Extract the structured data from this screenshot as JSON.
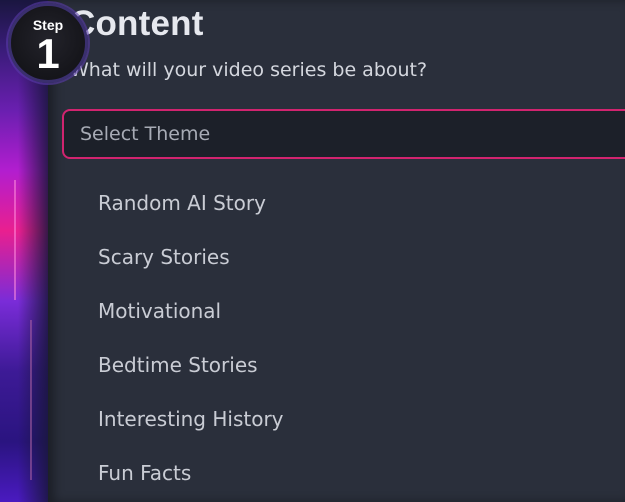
{
  "step_badge": {
    "label": "Step",
    "number": "1"
  },
  "section": {
    "title": "Content",
    "subtitle": "What will your video series be about?"
  },
  "theme_select": {
    "placeholder": "Select Theme",
    "options": [
      "Random AI Story",
      "Scary Stories",
      "Motivational",
      "Bedtime Stories",
      "Interesting History",
      "Fun Facts"
    ]
  },
  "colors": {
    "accent_border": "#d1246f",
    "panel_bg": "#2a2f3b",
    "select_bg": "#1c2029"
  }
}
